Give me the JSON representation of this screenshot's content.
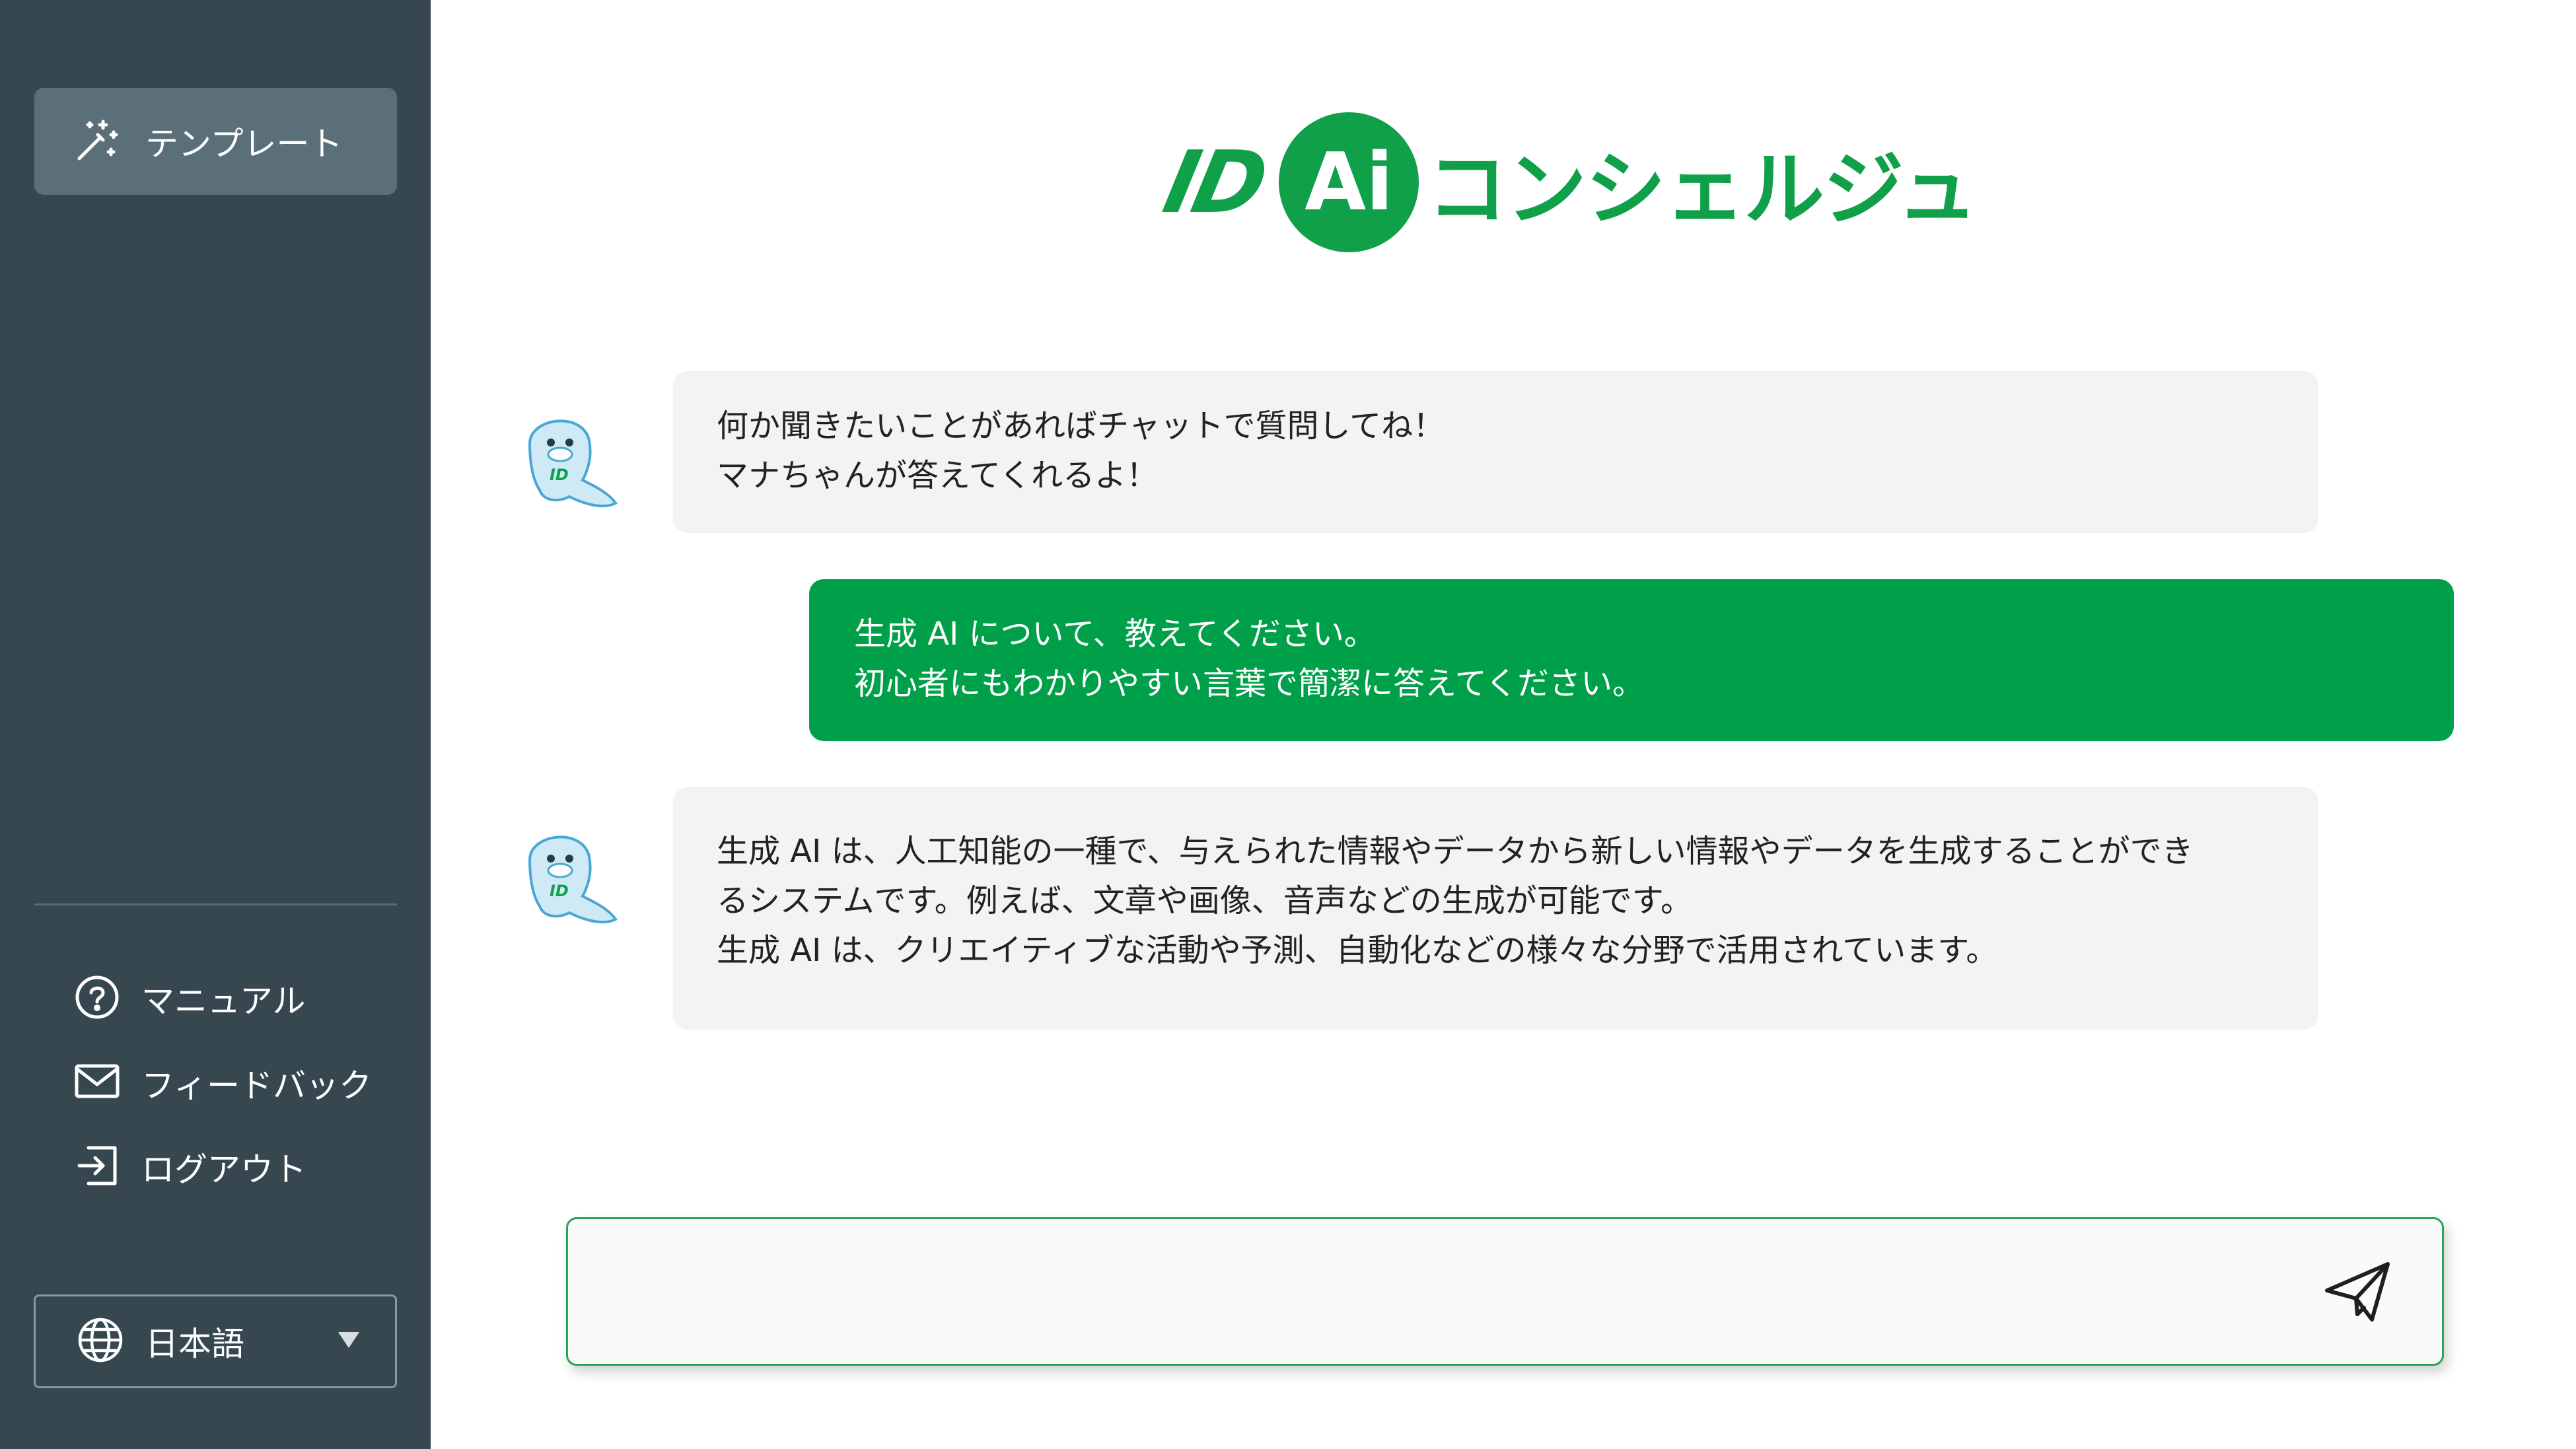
{
  "sidebar": {
    "template_label": "テンプレート",
    "links": [
      {
        "label": "マニュアル",
        "icon": "help-circle-icon"
      },
      {
        "label": "フィードバック",
        "icon": "mail-icon"
      },
      {
        "label": "ログアウト",
        "icon": "logout-icon"
      }
    ],
    "language": {
      "label": "日本語",
      "icon": "globe-icon"
    }
  },
  "logo": {
    "id_text": "ID",
    "ai_text": "Ai",
    "name": "コンシェルジュ"
  },
  "messages": [
    {
      "role": "bot",
      "lines": [
        "何か聞きたいことがあればチャットで質問してね！",
        "マナちゃんが答えてくれるよ！"
      ]
    },
    {
      "role": "user",
      "lines": [
        "生成 AI について、教えてください。",
        "初心者にもわかりやすい言葉で簡潔に答えてください。"
      ]
    },
    {
      "role": "bot",
      "lines": [
        "生成 AI は、人工知能の一種で、与えられた情報やデータから新しい情報やデータを生成することができ",
        "るシステムです。例えば、文章や画像、音声などの生成が可能です。",
        "生成 AI は、クリエイティブな活動や予測、自動化などの様々な分野で活用されています。"
      ]
    }
  ],
  "composer": {
    "value": "",
    "placeholder": "",
    "send_icon": "paper-plane-icon"
  },
  "colors": {
    "sidebar_bg": "#36474f",
    "sidebar_active": "#5b6f78",
    "brand_green": "#10a04a",
    "user_bubble": "#00a04a",
    "bot_bubble": "#f3f3f3"
  }
}
